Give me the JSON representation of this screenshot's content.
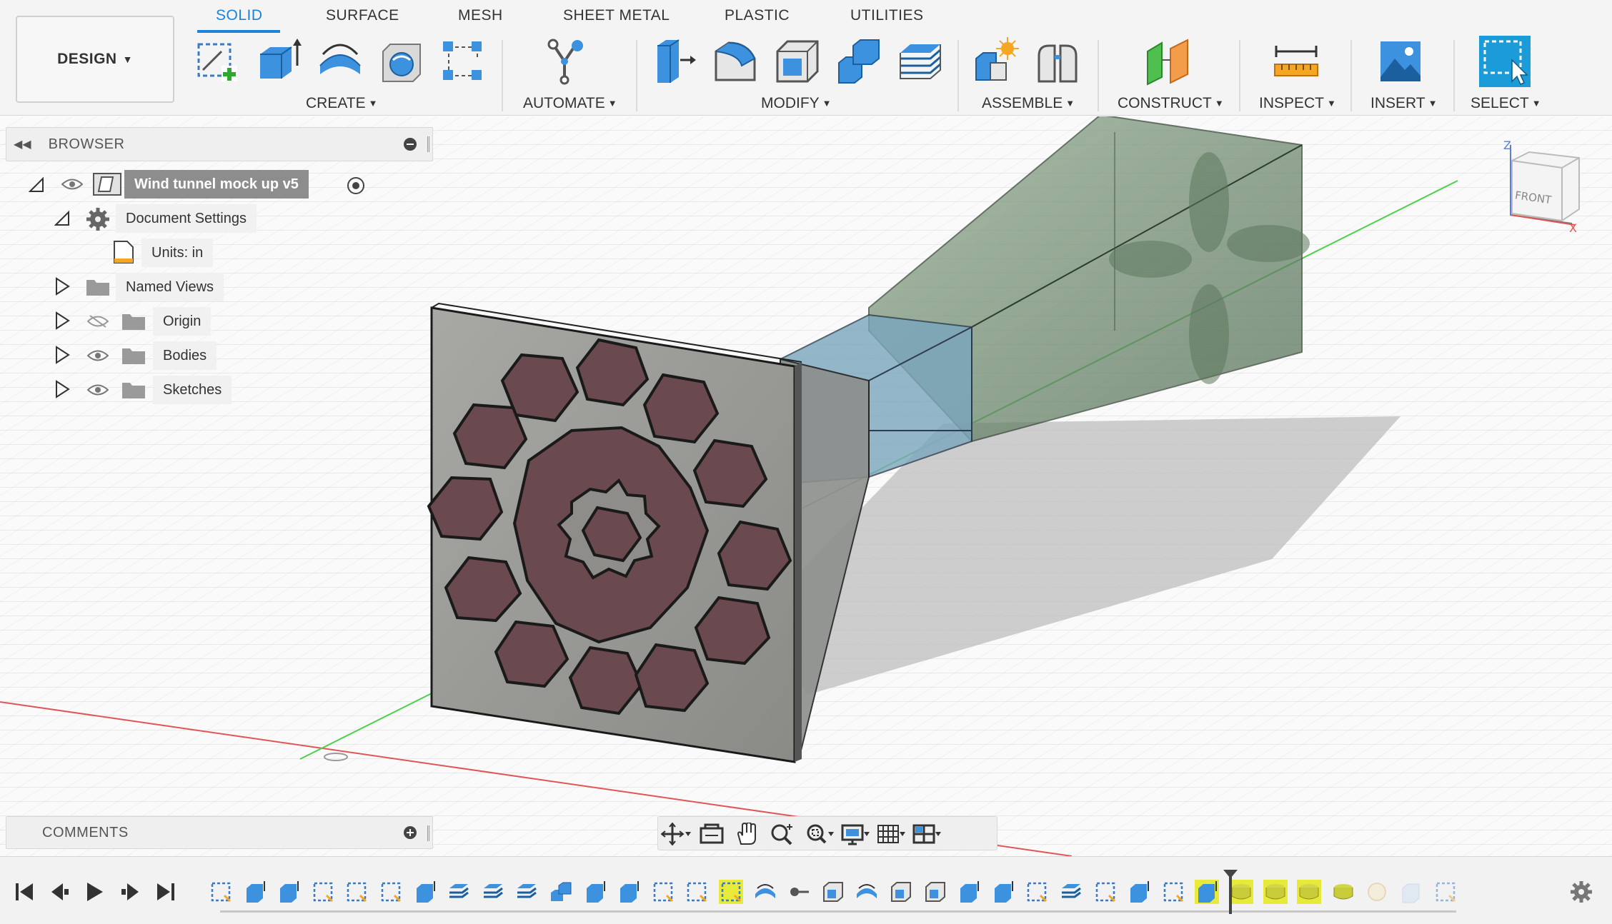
{
  "toolbar": {
    "workspace_button": "DESIGN",
    "tabs": [
      {
        "label": "SOLID",
        "active": true
      },
      {
        "label": "SURFACE",
        "active": false
      },
      {
        "label": "MESH",
        "active": false
      },
      {
        "label": "SHEET METAL",
        "active": false
      },
      {
        "label": "PLASTIC",
        "active": false
      },
      {
        "label": "UTILITIES",
        "active": false
      }
    ],
    "groups": {
      "create": "CREATE",
      "automate": "AUTOMATE",
      "modify": "MODIFY",
      "assemble": "ASSEMBLE",
      "construct": "CONSTRUCT",
      "inspect": "INSPECT",
      "insert": "INSERT",
      "select": "SELECT"
    },
    "tools": {
      "create": [
        "create-sketch-icon",
        "extrude-icon",
        "revolve-icon",
        "hole-icon",
        "pattern-icon"
      ],
      "automate": [
        "automate-icon"
      ],
      "modify": [
        "press-pull-icon",
        "fillet-icon",
        "shell-icon",
        "combine-icon",
        "offset-face-icon"
      ],
      "assemble": [
        "new-component-icon",
        "joint-icon"
      ],
      "construct": [
        "offset-plane-icon"
      ],
      "inspect": [
        "measure-icon"
      ],
      "insert": [
        "insert-image-icon"
      ],
      "select": [
        "select-window-icon"
      ]
    }
  },
  "browser": {
    "title": "BROWSER",
    "root_label": "Wind tunnel mock up v5",
    "items": [
      {
        "label": "Document Settings"
      },
      {
        "label": "Units: in"
      },
      {
        "label": "Named Views"
      },
      {
        "label": "Origin",
        "visible": false
      },
      {
        "label": "Bodies",
        "visible": true
      },
      {
        "label": "Sketches",
        "visible": true
      }
    ]
  },
  "comments": {
    "title": "COMMENTS"
  },
  "viewcube": {
    "face_label": "FRONT",
    "axes": [
      "Z",
      "X"
    ]
  },
  "colors": {
    "accent": "#1b83d8",
    "axis_red": "#e05555",
    "axis_green": "#4fcf4f",
    "timeline_highlight": "#e8ea3a"
  },
  "navbar": {
    "tools": [
      "orbit-icon",
      "look-at-icon",
      "pan-icon",
      "zoom-icon",
      "fit-icon",
      "display-settings-icon",
      "grid-icon",
      "viewports-icon"
    ]
  },
  "timeline": {
    "controls": [
      "skip-to-start-icon",
      "step-back-icon",
      "play-icon",
      "step-forward-icon",
      "skip-to-end-icon"
    ],
    "feature_count": 37
  }
}
